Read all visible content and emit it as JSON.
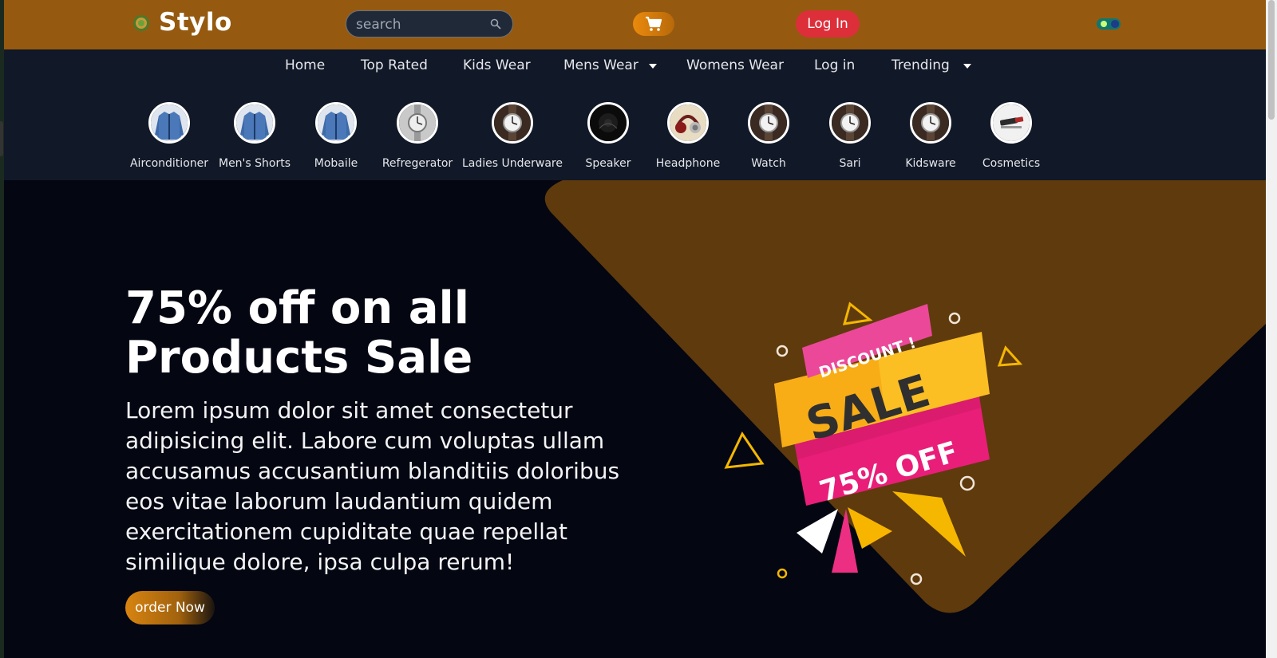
{
  "header": {
    "brand": "Stylo",
    "search_placeholder": "search",
    "login_label": "Log In"
  },
  "nav": {
    "items": [
      {
        "label": "Home"
      },
      {
        "label": "Top Rated"
      },
      {
        "label": "Kids Wear"
      },
      {
        "label": "Mens Wear",
        "dropdown": true
      },
      {
        "label": "Womens Wear"
      },
      {
        "label": "Log in"
      },
      {
        "label": "Trending",
        "dropdown": true
      }
    ]
  },
  "categories": [
    {
      "label": "Airconditioner",
      "icon": "jacket-thumb-icon"
    },
    {
      "label": "Men's Shorts",
      "icon": "jacket-thumb-icon"
    },
    {
      "label": "Mobaile",
      "icon": "jacket-thumb-icon"
    },
    {
      "label": "Refregerator",
      "icon": "watch-thumb-icon"
    },
    {
      "label": "Ladies Underware",
      "icon": "watch-thumb-icon"
    },
    {
      "label": "Speaker",
      "icon": "speaker-thumb-icon"
    },
    {
      "label": "Headphone",
      "icon": "headphone-thumb-icon"
    },
    {
      "label": "Watch",
      "icon": "watch-thumb-icon"
    },
    {
      "label": "Sari",
      "icon": "watch-thumb-icon"
    },
    {
      "label": "Kidsware",
      "icon": "watch-thumb-icon"
    },
    {
      "label": "Cosmetics",
      "icon": "cosmetics-thumb-icon"
    }
  ],
  "hero": {
    "title_line1": "75% off on all",
    "title_line2": "Products Sale",
    "description": "Lorem ipsum dolor sit amet consectetur adipisicing elit. Labore cum voluptas ullam accusamus accusantium blanditiis doloribus eos vitae laborum laudantium quidem exercitationem cupiditate quae repellat similique dolore, ipsa culpa rerum!",
    "cta_label": "order Now",
    "badge_top": "DISCOUNT !",
    "badge_main": "SALE",
    "badge_bottom": "75% OFF"
  },
  "colors": {
    "header_bg": "#955a10",
    "nav_bg": "#111827",
    "hero_bg": "#040612",
    "hero_shape": "#5f3a0d",
    "login_button": "#dc2f3a",
    "accent_orange": "#ea8a0c"
  }
}
